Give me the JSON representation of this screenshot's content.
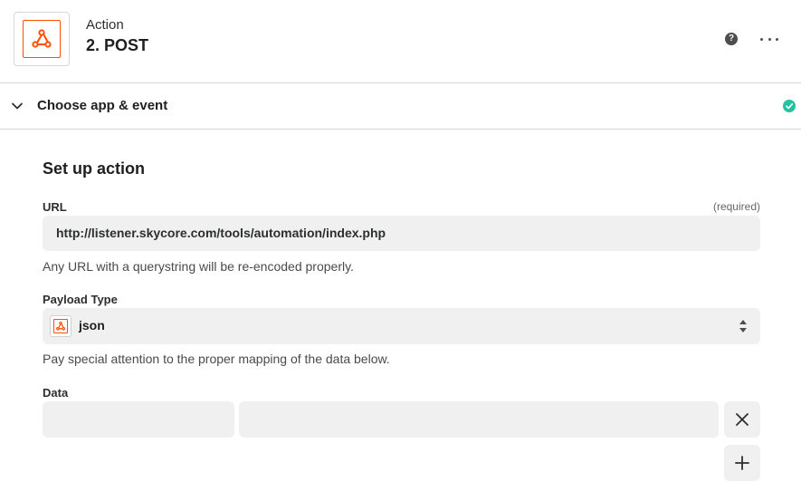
{
  "header": {
    "step_type": "Action",
    "step_title": "2. POST",
    "app_icon": "webhook-icon",
    "help_icon": "help-icon",
    "help_glyph": "?",
    "more_icon": "more-icon"
  },
  "section": {
    "label": "Choose app & event",
    "chevron_icon": "chevron-down-icon",
    "status_icon": "check-circle-icon",
    "status_color": "#25c2a0"
  },
  "setup": {
    "title": "Set up action",
    "url": {
      "label": "URL",
      "required_text": "(required)",
      "value": "http://listener.skycore.com/tools/automation/index.php",
      "help": "Any URL with a querystring will be re-encoded properly."
    },
    "payload_type": {
      "label": "Payload Type",
      "selected": "json",
      "icon": "webhook-icon",
      "arrows_icon": "select-arrows-icon",
      "help": "Pay special attention to the proper mapping of the data below."
    },
    "data": {
      "label": "Data",
      "key_value": "",
      "value_value": "",
      "remove_icon": "close-icon",
      "add_icon": "plus-icon"
    }
  },
  "colors": {
    "brand": "#ff4f00",
    "input_bg": "#f0f0f0",
    "divider": "#d5d5d5"
  }
}
